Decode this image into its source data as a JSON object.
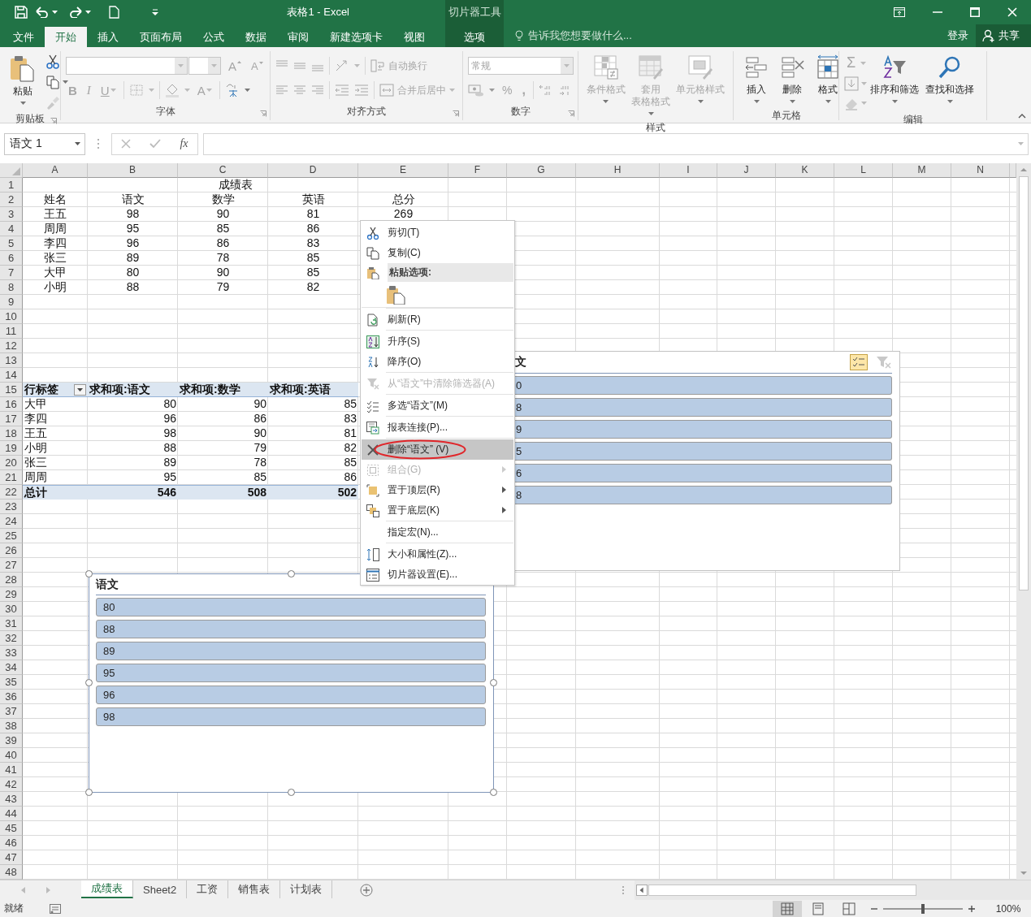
{
  "titlebar": {
    "title": "表格1 - Excel",
    "context_label": "切片器工具"
  },
  "tabs": [
    {
      "label": "文件",
      "selected": false
    },
    {
      "label": "开始",
      "selected": true
    },
    {
      "label": "插入",
      "selected": false
    },
    {
      "label": "页面布局",
      "selected": false
    },
    {
      "label": "公式",
      "selected": false
    },
    {
      "label": "数据",
      "selected": false
    },
    {
      "label": "审阅",
      "selected": false
    },
    {
      "label": "新建选项卡",
      "selected": false
    },
    {
      "label": "视图",
      "selected": false
    },
    {
      "label": "选项",
      "selected": false,
      "kind": "contextual"
    }
  ],
  "tell_me": "告诉我您想要做什么...",
  "sign_in": "登录",
  "share": "共享",
  "ribbon": {
    "groups": [
      {
        "kind": "clipboard",
        "label": "剪贴板",
        "launcher": true,
        "buttons": [
          {
            "kind": "paste",
            "label": "粘贴",
            "disabled": false
          }
        ]
      },
      {
        "kind": "font",
        "label": "字体",
        "launcher": true,
        "controls": [
          {
            "kind": "grow",
            "label": "A",
            "disabled": true
          },
          {
            "kind": "shrink",
            "label": "A",
            "disabled": true
          },
          {
            "kind": "bold",
            "label": "B",
            "disabled": true
          },
          {
            "kind": "italic",
            "label": "I",
            "disabled": true
          },
          {
            "kind": "underline",
            "label": "U",
            "disabled": true
          },
          {
            "kind": "font-color",
            "label": "A",
            "disabled": true
          }
        ]
      },
      {
        "kind": "alignment",
        "label": "对齐方式",
        "launcher": true,
        "buttons": [
          {
            "kind": "wrap",
            "label": "自动换行",
            "disabled": true
          },
          {
            "kind": "merge",
            "label": "合并后居中",
            "disabled": true
          }
        ]
      },
      {
        "kind": "number",
        "label": "数字",
        "launcher": true,
        "format": {
          "value": "常规",
          "disabled": true
        },
        "buttons": [
          {
            "kind": "percent",
            "label": "%",
            "disabled": true
          },
          {
            "kind": "comma",
            "label": ",",
            "disabled": true
          }
        ]
      },
      {
        "kind": "styles",
        "label": "样式",
        "launcher": false,
        "buttons": [
          {
            "kind": "conditional",
            "label": "条件格式",
            "disabled": true
          },
          {
            "kind": "table",
            "lines": [
              "套用",
              "表格格式"
            ],
            "disabled": true
          },
          {
            "kind": "cellstyle",
            "label": "单元格样式",
            "disabled": true
          }
        ]
      },
      {
        "kind": "cells",
        "label": "单元格",
        "launcher": false,
        "buttons": [
          {
            "kind": "insert",
            "label": "插入",
            "disabled": false
          },
          {
            "kind": "delete",
            "label": "删除",
            "disabled": false
          },
          {
            "kind": "format",
            "label": "格式",
            "disabled": false
          }
        ]
      },
      {
        "kind": "editing",
        "label": "编辑",
        "launcher": false,
        "sum": {
          "label": "Σ",
          "disabled": true
        },
        "buttons": [
          {
            "kind": "sort",
            "label": "排序和筛选",
            "disabled": false
          },
          {
            "kind": "find",
            "label": "查找和选择",
            "disabled": false
          }
        ]
      }
    ]
  },
  "formula_bar": {
    "name_box": "语文 1",
    "function_button": "fx"
  },
  "sheet": {
    "columns": [
      "A",
      "B",
      "C",
      "D",
      "E",
      "F",
      "G",
      "H",
      "I",
      "J",
      "K",
      "L",
      "M",
      "N"
    ],
    "rows": [
      {
        "number": "1",
        "kind": "table-title",
        "cells": [
          "成绩表"
        ]
      },
      {
        "number": "2",
        "kind": "table",
        "cells": [
          "姓名",
          "语文",
          "数学",
          "英语",
          "总分"
        ]
      },
      {
        "number": "3",
        "kind": "table",
        "cells": [
          "王五",
          "98",
          "90",
          "81",
          "269"
        ]
      },
      {
        "number": "4",
        "kind": "table",
        "cells": [
          "周周",
          "95",
          "85",
          "86"
        ]
      },
      {
        "number": "5",
        "kind": "table",
        "cells": [
          "李四",
          "96",
          "86",
          "83"
        ]
      },
      {
        "number": "6",
        "kind": "table",
        "cells": [
          "张三",
          "89",
          "78",
          "85"
        ]
      },
      {
        "number": "7",
        "kind": "table",
        "cells": [
          "大甲",
          "80",
          "90",
          "85"
        ]
      },
      {
        "number": "8",
        "kind": "table",
        "cells": [
          "小明",
          "88",
          "79",
          "82"
        ]
      },
      {
        "number": "9"
      },
      {
        "number": "10"
      },
      {
        "number": "11"
      },
      {
        "number": "12"
      },
      {
        "number": "13"
      },
      {
        "number": "14"
      },
      {
        "number": "15",
        "kind": "pivot-header",
        "filter": true,
        "cells": [
          "行标签",
          "求和项:语文",
          "求和项:数学",
          "求和项:英语"
        ]
      },
      {
        "number": "16",
        "kind": "pivot-row",
        "cells": [
          "大甲",
          "80",
          "90",
          "85"
        ]
      },
      {
        "number": "17",
        "kind": "pivot-row",
        "cells": [
          "李四",
          "96",
          "86",
          "83"
        ]
      },
      {
        "number": "18",
        "kind": "pivot-row",
        "cells": [
          "王五",
          "98",
          "90",
          "81"
        ]
      },
      {
        "number": "19",
        "kind": "pivot-row",
        "cells": [
          "小明",
          "88",
          "79",
          "82"
        ]
      },
      {
        "number": "20",
        "kind": "pivot-row",
        "cells": [
          "张三",
          "89",
          "78",
          "85"
        ]
      },
      {
        "number": "21",
        "kind": "pivot-row",
        "cells": [
          "周周",
          "95",
          "85",
          "86"
        ]
      },
      {
        "number": "22",
        "kind": "pivot-total",
        "cells": [
          "总计",
          "546",
          "508",
          "502"
        ]
      },
      {
        "number": "23"
      },
      {
        "number": "24"
      },
      {
        "number": "25"
      },
      {
        "number": "26"
      },
      {
        "number": "27"
      },
      {
        "number": "28"
      },
      {
        "number": "29"
      },
      {
        "number": "30"
      },
      {
        "number": "31"
      },
      {
        "number": "32"
      },
      {
        "number": "33"
      },
      {
        "number": "34"
      },
      {
        "number": "35"
      },
      {
        "number": "36"
      },
      {
        "number": "37"
      },
      {
        "number": "38"
      },
      {
        "number": "39"
      },
      {
        "number": "40"
      },
      {
        "number": "41"
      },
      {
        "number": "42"
      },
      {
        "number": "43"
      },
      {
        "number": "44"
      },
      {
        "number": "45"
      },
      {
        "number": "46"
      },
      {
        "number": "47"
      },
      {
        "number": "48"
      }
    ]
  },
  "slicers": [
    {
      "kind": "partial",
      "title": "文",
      "selected": false,
      "multi_select": true,
      "items": [
        {
          "label": "0",
          "selected": true
        },
        {
          "label": "8",
          "selected": true
        },
        {
          "label": "9",
          "selected": true
        },
        {
          "label": "5",
          "selected": true
        },
        {
          "label": "6",
          "selected": true
        },
        {
          "label": "8",
          "selected": true
        }
      ]
    },
    {
      "kind": "full",
      "title": "语文",
      "selected": true,
      "items": [
        {
          "label": "80",
          "selected": true
        },
        {
          "label": "88",
          "selected": true
        },
        {
          "label": "89",
          "selected": true
        },
        {
          "label": "95",
          "selected": true
        },
        {
          "label": "96",
          "selected": true
        },
        {
          "label": "98",
          "selected": true
        }
      ]
    }
  ],
  "context_menu": {
    "items": [
      {
        "kind": "item",
        "label": "剪切(T)",
        "disabled": false,
        "highlighted": false,
        "submenu": false,
        "annotated": false
      },
      {
        "kind": "item",
        "label": "复制(C)",
        "disabled": false,
        "highlighted": false,
        "submenu": false,
        "annotated": false
      },
      {
        "kind": "header",
        "label": "粘贴选项:"
      },
      {
        "kind": "paste-options"
      },
      {
        "kind": "separator"
      },
      {
        "kind": "item",
        "label": "刷新(R)",
        "disabled": false,
        "highlighted": false,
        "submenu": false,
        "annotated": false
      },
      {
        "kind": "separator"
      },
      {
        "kind": "item",
        "label": "升序(S)",
        "disabled": false,
        "highlighted": false,
        "submenu": false,
        "annotated": false
      },
      {
        "kind": "item",
        "label": "降序(O)",
        "disabled": false,
        "highlighted": false,
        "submenu": false,
        "annotated": false
      },
      {
        "kind": "separator"
      },
      {
        "kind": "item",
        "label": "从“语文”中清除筛选器(A)",
        "disabled": true,
        "highlighted": false,
        "submenu": false,
        "annotated": false
      },
      {
        "kind": "separator"
      },
      {
        "kind": "item",
        "label": "多选“语文”(M)",
        "disabled": false,
        "highlighted": false,
        "submenu": false,
        "annotated": false
      },
      {
        "kind": "separator"
      },
      {
        "kind": "item",
        "label": "报表连接(P)...",
        "disabled": false,
        "highlighted": false,
        "submenu": false,
        "annotated": false
      },
      {
        "kind": "separator"
      },
      {
        "kind": "item",
        "label": "删除“语文” (V)",
        "disabled": false,
        "highlighted": true,
        "submenu": false,
        "annotated": true
      },
      {
        "kind": "item",
        "label": "组合(G)",
        "disabled": true,
        "highlighted": false,
        "submenu": true,
        "annotated": false
      },
      {
        "kind": "item",
        "label": "置于顶层(R)",
        "disabled": false,
        "highlighted": false,
        "submenu": true,
        "annotated": false
      },
      {
        "kind": "item",
        "label": "置于底层(K)",
        "disabled": false,
        "highlighted": false,
        "submenu": true,
        "annotated": false
      },
      {
        "kind": "separator"
      },
      {
        "kind": "item",
        "label": "指定宏(N)...",
        "disabled": false,
        "highlighted": false,
        "submenu": false,
        "annotated": false
      },
      {
        "kind": "separator"
      },
      {
        "kind": "item",
        "label": "大小和属性(Z)...",
        "disabled": false,
        "highlighted": false,
        "submenu": false,
        "annotated": false
      },
      {
        "kind": "item",
        "label": "切片器设置(E)...",
        "disabled": false,
        "highlighted": false,
        "submenu": false,
        "annotated": false
      }
    ]
  },
  "sheet_tabs": [
    {
      "label": "成绩表",
      "selected": true
    },
    {
      "label": "Sheet2",
      "selected": false
    },
    {
      "label": "工资",
      "selected": false
    },
    {
      "label": "销售表",
      "selected": false
    },
    {
      "label": "计划表",
      "selected": false
    }
  ],
  "status_bar": {
    "text": "就绪",
    "zoom": {
      "label": "100%",
      "level": 0.5
    }
  }
}
